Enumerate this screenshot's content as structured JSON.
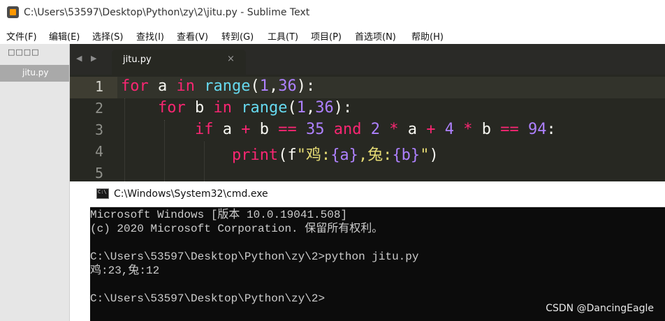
{
  "window": {
    "title": "C:\\Users\\53597\\Desktop\\Python\\zy\\2\\jitu.py - Sublime Text"
  },
  "menu": {
    "items": [
      "文件(F)",
      "编辑(E)",
      "选择(S)",
      "查找(I)",
      "查看(V)",
      "转到(G)",
      "工具(T)",
      "项目(P)",
      "首选项(N)",
      "帮助(H)"
    ]
  },
  "sidebar": {
    "heading": "□□□□",
    "file": "jitu.py"
  },
  "tabs": {
    "prev_arrow": "◀",
    "next_arrow": "▶",
    "active_tab": "jitu.py",
    "close_glyph": "×"
  },
  "editor": {
    "line_numbers": [
      "1",
      "2",
      "3",
      "4",
      "5"
    ],
    "lines": [
      [
        [
          "kw",
          "for"
        ],
        [
          "t",
          " a "
        ],
        [
          "kw",
          "in"
        ],
        [
          "t",
          " "
        ],
        [
          "bi",
          "range"
        ],
        [
          "t",
          "("
        ],
        [
          "num",
          "1"
        ],
        [
          "t",
          ","
        ],
        [
          "num",
          "36"
        ],
        [
          "t",
          "):"
        ]
      ],
      [
        [
          "t",
          "    "
        ],
        [
          "kw",
          "for"
        ],
        [
          "t",
          " b "
        ],
        [
          "kw",
          "in"
        ],
        [
          "t",
          " "
        ],
        [
          "bi",
          "range"
        ],
        [
          "t",
          "("
        ],
        [
          "num",
          "1"
        ],
        [
          "t",
          ","
        ],
        [
          "num",
          "36"
        ],
        [
          "t",
          "):"
        ]
      ],
      [
        [
          "t",
          "        "
        ],
        [
          "kw",
          "if"
        ],
        [
          "t",
          " a "
        ],
        [
          "kw",
          "+"
        ],
        [
          "t",
          " b "
        ],
        [
          "kw",
          "=="
        ],
        [
          "t",
          " "
        ],
        [
          "num",
          "35"
        ],
        [
          "t",
          " "
        ],
        [
          "kw",
          "and"
        ],
        [
          "t",
          " "
        ],
        [
          "num",
          "2"
        ],
        [
          "t",
          " "
        ],
        [
          "kw",
          "*"
        ],
        [
          "t",
          " a "
        ],
        [
          "kw",
          "+"
        ],
        [
          "t",
          " "
        ],
        [
          "num",
          "4"
        ],
        [
          "t",
          " "
        ],
        [
          "kw",
          "*"
        ],
        [
          "t",
          " b "
        ],
        [
          "kw",
          "=="
        ],
        [
          "t",
          " "
        ],
        [
          "num",
          "94"
        ],
        [
          "t",
          ":"
        ]
      ],
      [
        [
          "t",
          "            "
        ],
        [
          "kw",
          "print"
        ],
        [
          "t",
          "("
        ],
        [
          "t",
          "f"
        ],
        [
          "str",
          "\"鸡:"
        ],
        [
          "num",
          "{a}"
        ],
        [
          "str",
          ",兔:"
        ],
        [
          "num",
          "{b}"
        ],
        [
          "str",
          "\""
        ],
        [
          "t",
          ")"
        ]
      ],
      []
    ]
  },
  "cmd": {
    "title": "C:\\Windows\\System32\\cmd.exe",
    "lines": [
      "Microsoft Windows [版本 10.0.19041.508]",
      "(c) 2020 Microsoft Corporation. 保留所有权利。",
      "",
      "C:\\Users\\53597\\Desktop\\Python\\zy\\2>python jitu.py",
      "鸡:23,兔:12",
      "",
      "C:\\Users\\53597\\Desktop\\Python\\zy\\2>"
    ]
  },
  "watermark": "CSDN @DancingEagle",
  "colors": {
    "editor_bg": "#272822",
    "keyword": "#f92672",
    "builtin": "#66d9ef",
    "number": "#ae81ff",
    "string": "#e6db74",
    "console_bg": "#0c0c0c",
    "console_text": "#cccccc"
  }
}
